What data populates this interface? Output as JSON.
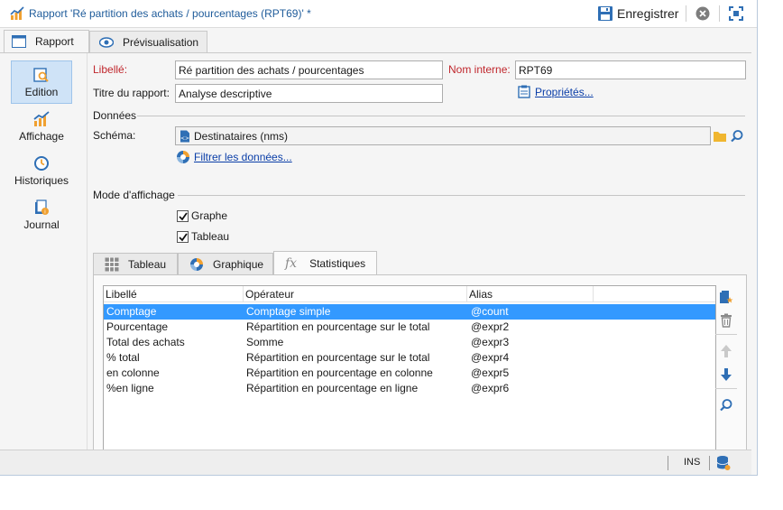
{
  "window": {
    "title": "Rapport 'Ré partition des achats / pourcentages (RPT69)' *",
    "save_label": "Enregistrer"
  },
  "main_tabs": [
    {
      "label": "Rapport",
      "icon": "report-form-icon"
    },
    {
      "label": "Prévisualisation",
      "icon": "eye-icon"
    }
  ],
  "nav": [
    {
      "label": "Edition",
      "icon": "edit-search-icon",
      "active": true
    },
    {
      "label": "Affichage",
      "icon": "chart-icon"
    },
    {
      "label": "Historiques",
      "icon": "clock-icon"
    },
    {
      "label": "Journal",
      "icon": "journal-icon"
    }
  ],
  "form": {
    "libelle_label": "Libellé:",
    "libelle_value": "Ré partition des achats / pourcentages",
    "nom_interne_label": "Nom interne:",
    "nom_interne_value": "RPT69",
    "titre_label": "Titre du rapport:",
    "titre_value": "Analyse descriptive",
    "proprietes_link": "Propriétés...",
    "donnees_section": "Données",
    "schema_label": "Schéma:",
    "schema_value": "Destinataires (nms)",
    "filtrer_link": "Filtrer les données...",
    "mode_section": "Mode d'affichage",
    "graphe_label": "Graphe",
    "graphe_checked": true,
    "tableau_label": "Tableau",
    "tableau_checked": true
  },
  "inner_tabs": [
    {
      "label": "Tableau",
      "icon": "table-grid-icon"
    },
    {
      "label": "Graphique",
      "icon": "pie-chart-icon"
    },
    {
      "label": "Statistiques",
      "icon": "fx-icon",
      "active": true
    }
  ],
  "grid": {
    "columns": [
      "Libellé",
      "Opérateur",
      "Alias"
    ],
    "rows": [
      {
        "libelle": "Comptage",
        "operateur": "Comptage simple",
        "alias": "@count",
        "selected": true
      },
      {
        "libelle": "Pourcentage",
        "operateur": "Répartition en pourcentage sur le total",
        "alias": "@expr2"
      },
      {
        "libelle": "Total des achats",
        "operateur": "Somme",
        "alias": "@expr3"
      },
      {
        "libelle": "% total",
        "operateur": "Répartition en pourcentage sur le total",
        "alias": "@expr4"
      },
      {
        "libelle": "en colonne",
        "operateur": "Répartition en pourcentage en colonne",
        "alias": "@expr5"
      },
      {
        "libelle": "%en ligne",
        "operateur": "Répartition en pourcentage en ligne",
        "alias": "@expr6"
      }
    ]
  },
  "statusbar": {
    "ins": "INS"
  },
  "colors": {
    "accent": "#1e5b9a",
    "selection": "#3399ff",
    "required_label": "#c0272d",
    "link": "#0a3ea8"
  }
}
